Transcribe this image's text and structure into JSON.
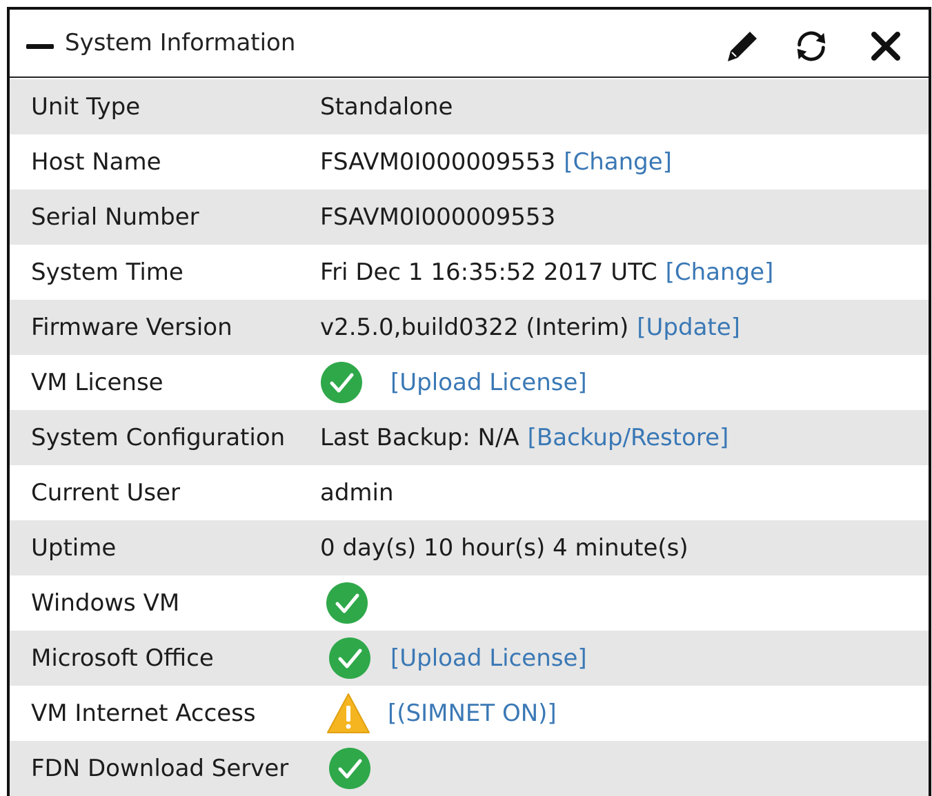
{
  "widget": {
    "title": "System Information",
    "icons": {
      "collapse": "minus-icon",
      "edit": "pencil-icon",
      "refresh": "refresh-icon",
      "close": "close-icon"
    }
  },
  "colors": {
    "link": "#3a78b5",
    "ok": "#2fa84a",
    "warning": "#f5b520",
    "row_shade": "#e6e6e6"
  },
  "rows": [
    {
      "label": "Unit Type",
      "value": "Standalone"
    },
    {
      "label": "Host Name",
      "value": "FSAVM0I000009553",
      "link": "[Change]"
    },
    {
      "label": "Serial Number",
      "value": "FSAVM0I000009553"
    },
    {
      "label": "System Time",
      "value": "Fri Dec 1 16:35:52 2017 UTC",
      "link": "[Change]"
    },
    {
      "label": "Firmware Version",
      "value": "v2.5.0,build0322 (Interim)",
      "link": "[Update]"
    },
    {
      "label": "VM License",
      "status": "ok",
      "link": "[Upload License]"
    },
    {
      "label": "System Configuration",
      "value": "Last Backup: N/A",
      "link": "[Backup/Restore]"
    },
    {
      "label": "Current User",
      "value": "admin"
    },
    {
      "label": "Uptime",
      "value": "0 day(s) 10 hour(s) 4 minute(s)"
    },
    {
      "label": "Windows VM",
      "status": "ok"
    },
    {
      "label": "Microsoft Office",
      "status": "ok",
      "link": "[Upload License]"
    },
    {
      "label": "VM Internet Access",
      "status": "warning",
      "link": "[(SIMNET ON)]"
    },
    {
      "label": "FDN Download Server",
      "status": "ok"
    }
  ]
}
